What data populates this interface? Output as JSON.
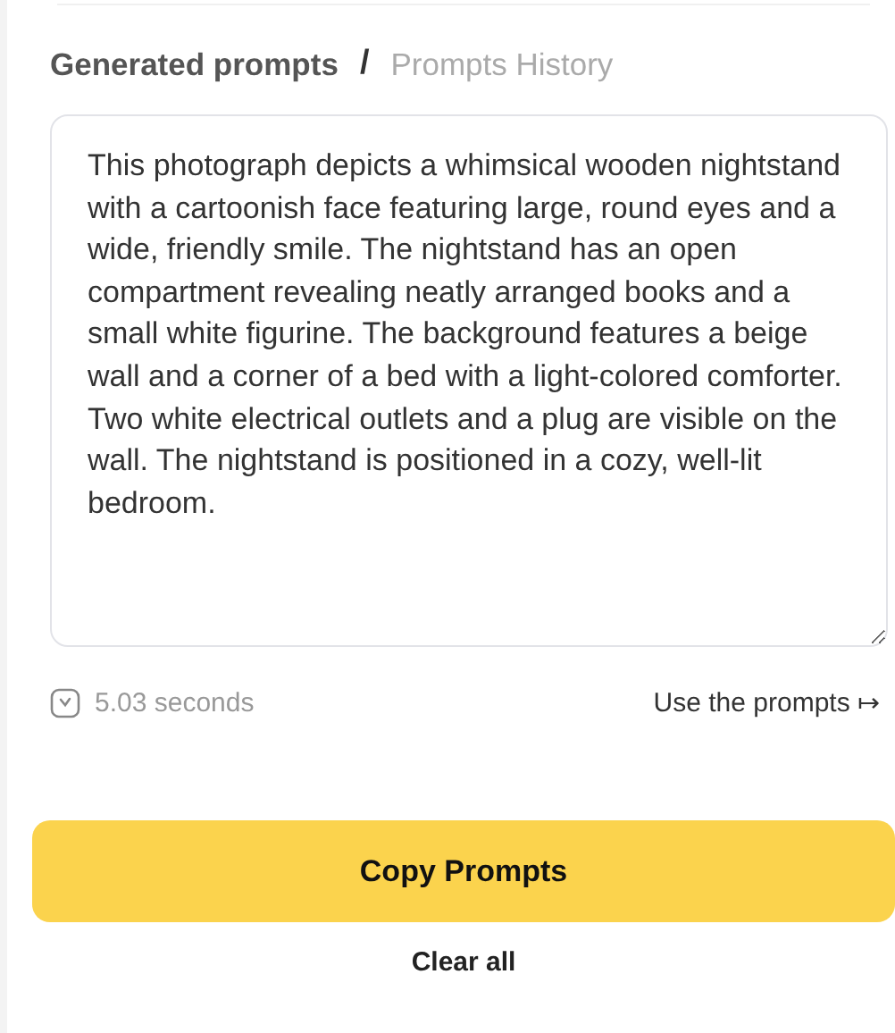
{
  "tabs": [
    {
      "label": "Generated prompts",
      "selected": true
    },
    {
      "label": "Prompts History",
      "selected": false
    }
  ],
  "separator": "/",
  "prompt": {
    "value": "This photograph depicts a whimsical wooden nightstand with a cartoonish face featuring large, round eyes and a wide, friendly smile. The nightstand has an open compartment revealing neatly arranged books and a small white figurine. The background features a beige wall and a corner of a bed with a light-colored comforter. Two white electrical outlets and a plug are visible on the wall. The nightstand is positioned in a cozy, well-lit bedroom."
  },
  "duration": "5.03 seconds",
  "use_link": "Use the prompts ↦",
  "copy_button": "Copy Prompts",
  "clear_button": "Clear all"
}
